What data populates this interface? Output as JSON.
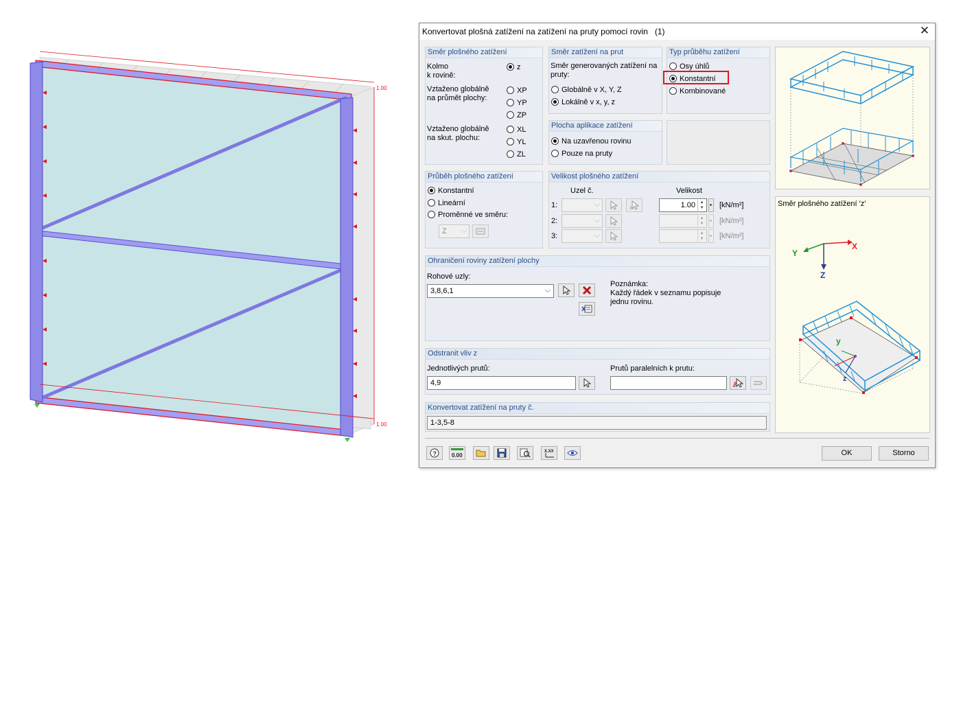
{
  "model_view": {
    "dim_top": "1.00",
    "dim_bottom": "1.00"
  },
  "dialog": {
    "title": "Konvertovat plošná zatížení na zatížení na pruty pomocí rovin",
    "title_count": "(1)",
    "close_glyph": "✕",
    "area_load_direction": {
      "header": "Směr plošného zatížení",
      "perp_label_1": "Kolmo",
      "perp_label_2": "k rovině:",
      "opt_z": "z",
      "proj_label_1": "Vztaženo globálně",
      "proj_label_2": "na průmět plochy:",
      "opt_xp": "XP",
      "opt_yp": "YP",
      "opt_zp": "ZP",
      "true_label_1": "Vztaženo globálně",
      "true_label_2": "na skut. plochu:",
      "opt_xl": "XL",
      "opt_yl": "YL",
      "opt_zl": "ZL",
      "selected": "z"
    },
    "member_load_direction": {
      "header": "Směr zatížení na prut",
      "desc_1": "Směr generovaných zatížení na",
      "desc_2": "pruty:",
      "opt_global": "Globálně v X, Y, Z",
      "opt_local": "Lokálně v x, y, z",
      "selected": "local"
    },
    "distribution_type": {
      "header": "Typ průběhu zatížení",
      "opt_angle": "Osy úhlů",
      "opt_constant": "Konstantní",
      "opt_combined": "Kombinované",
      "selected": "constant",
      "highlight_color": "#e0141e"
    },
    "application_area": {
      "header": "Plocha aplikace zatížení",
      "opt_closed": "Na uzavřenou rovinu",
      "opt_members": "Pouze na pruty",
      "selected": "closed"
    },
    "area_load_distribution": {
      "header": "Průběh plošného zatížení",
      "opt_constant": "Konstantní",
      "opt_linear": "Lineární",
      "opt_variable": "Proměnné ve směru:",
      "direction_value": "Z",
      "selected": "constant"
    },
    "area_load_magnitude": {
      "header": "Velikost plošného zatížení",
      "col_node": "Uzel č.",
      "col_magnitude": "Velikost",
      "rows": [
        {
          "label": "1:",
          "magnitude": "1.00",
          "unit": "[kN/m²]"
        },
        {
          "label": "2:",
          "magnitude": "",
          "unit": "[kN/m²]"
        },
        {
          "label": "3:",
          "magnitude": "",
          "unit": "[kN/m²]"
        }
      ]
    },
    "plane_boundary": {
      "header": "Ohraničení roviny zatížení plochy",
      "corner_label": "Rohové uzly:",
      "corner_value": "3,8,6,1",
      "note_title": "Poznámka:",
      "note_1": "Každý řádek v seznamu popisuje",
      "note_2": "jednu rovinu."
    },
    "remove_influence": {
      "header": "Odstranit vliv z",
      "single_label": "Jednotlivých prutů:",
      "single_value": "4,9",
      "parallel_label": "Prutů paralelních k prutu:",
      "parallel_value": ""
    },
    "convert_members": {
      "header": "Konvertovat zatížení na pruty č.",
      "value": "1-3,5-8"
    },
    "preview_caption": "Směr plošného zatížení 'z'",
    "axes": {
      "x": "X",
      "y": "Y",
      "z": "Z",
      "ly": "y",
      "lz": "z"
    },
    "ok": "OK",
    "cancel": "Storno",
    "toolbar_num": "0.00"
  },
  "colors": {
    "group_header_text": "#2a4f86",
    "load_blue": "#1e8fd6",
    "axis_red": "#e02020",
    "axis_green": "#1f9a2a",
    "axis_blue": "#2b3f8f",
    "surface_fill": "#c9e4e6",
    "member_purple": "#7e78e0"
  }
}
